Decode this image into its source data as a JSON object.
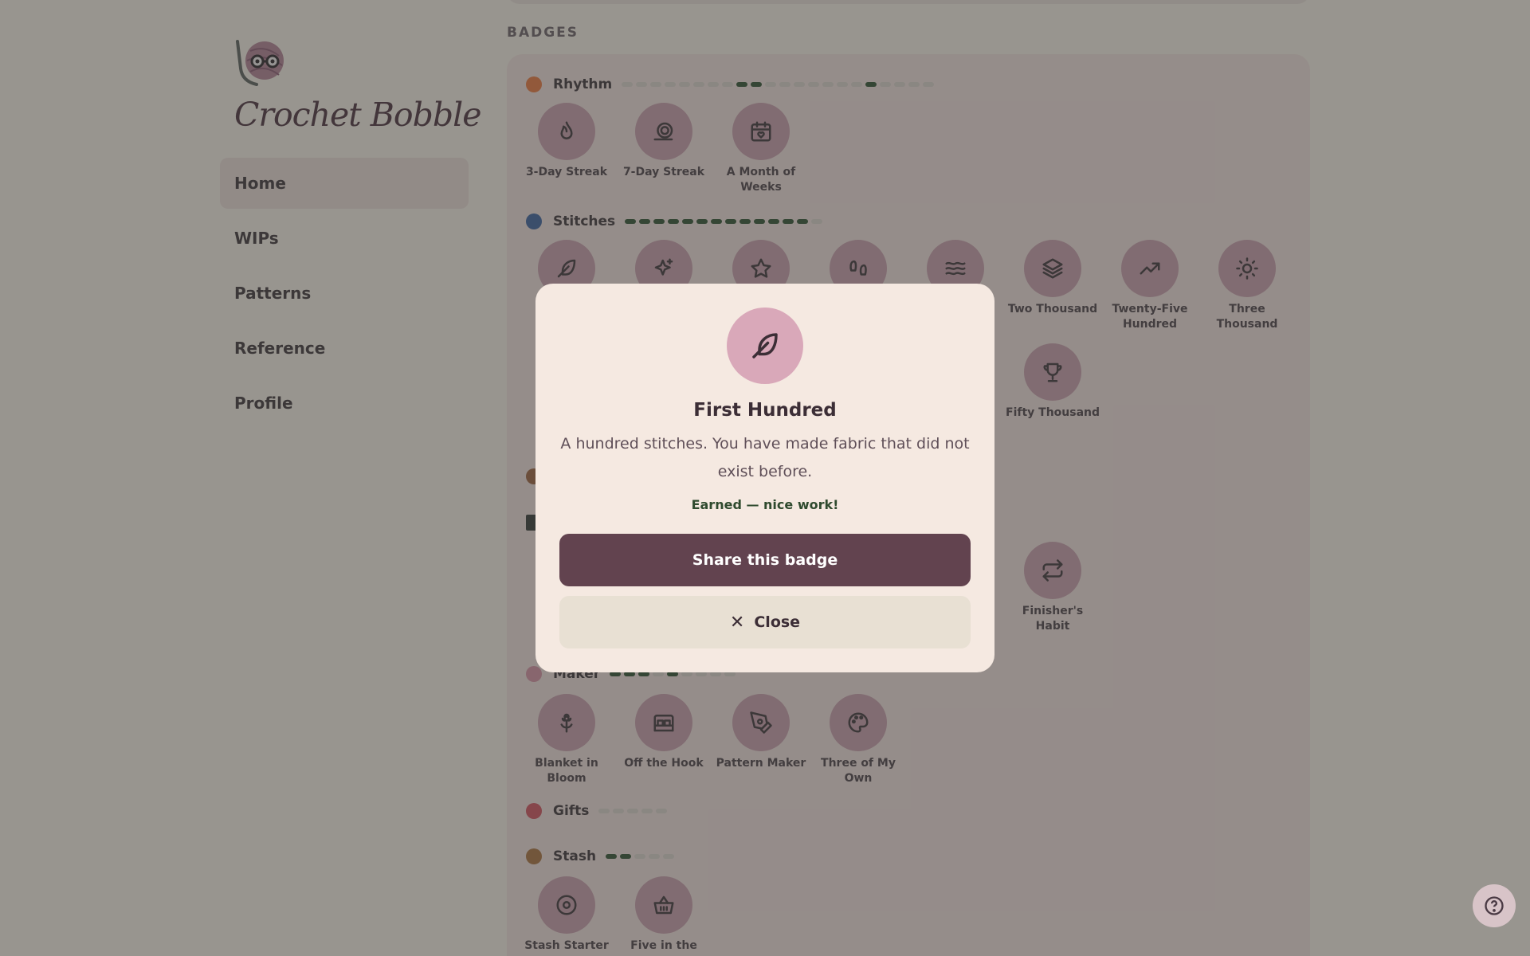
{
  "app": {
    "logo_text": "Crochet Bobble"
  },
  "nav": [
    {
      "label": "Home",
      "active": true
    },
    {
      "label": "WIPs"
    },
    {
      "label": "Patterns"
    },
    {
      "label": "Reference"
    },
    {
      "label": "Profile"
    }
  ],
  "badges_section": {
    "title": "BADGES",
    "categories": {
      "rhythm": {
        "label": "Rhythm",
        "badges": [
          {
            "label": "3-Day Streak",
            "icon": "flame-icon"
          },
          {
            "label": "7-Day Streak",
            "icon": "snail-icon"
          },
          {
            "label": "A Month of Weeks",
            "icon": "calendar-heart-icon"
          }
        ]
      },
      "stitches": {
        "label": "Stitches",
        "badges": [
          {
            "label": "Two Thousand",
            "icon": "layers-icon"
          },
          {
            "label": "Twenty-Five Hundred",
            "icon": "trending-up-icon"
          },
          {
            "label": "Three Thousand",
            "icon": "sun-icon"
          },
          {
            "label": "Fifty Thousand",
            "icon": "trophy-icon"
          }
        ],
        "partially_hidden_icons": [
          "feather-icon",
          "sparkles-icon",
          "star-icon",
          "footprints-icon",
          "waves-icon"
        ]
      },
      "finishing": {
        "badges": [
          {
            "label": "Finisher's Habit",
            "icon": "repeat-icon"
          }
        ]
      },
      "maker": {
        "label": "Maker",
        "badges": [
          {
            "label": "Blanket in Bloom",
            "icon": "flower-icon"
          },
          {
            "label": "Off the Hook",
            "icon": "bed-icon"
          },
          {
            "label": "Pattern Maker",
            "icon": "pen-tool-icon"
          },
          {
            "label": "Three of My Own",
            "icon": "palette-icon"
          }
        ]
      },
      "gifts": {
        "label": "Gifts"
      },
      "stash": {
        "label": "Stash",
        "badges": [
          {
            "label": "Stash Starter",
            "icon": "donut-icon"
          },
          {
            "label": "Five in the",
            "icon": "basket-icon"
          }
        ]
      }
    }
  },
  "modal": {
    "icon": "feather-icon",
    "title": "First Hundred",
    "description": "A hundred stitches. You have made fabric that did not exist before.",
    "status": "Earned — nice work!",
    "share_label": "Share this badge",
    "close_label": "Close"
  },
  "colors": {
    "accent": "#62434f",
    "earned": "#2f4a2e",
    "badge_bg": "#c797a8",
    "modal_bg": "#f5e9e1"
  }
}
